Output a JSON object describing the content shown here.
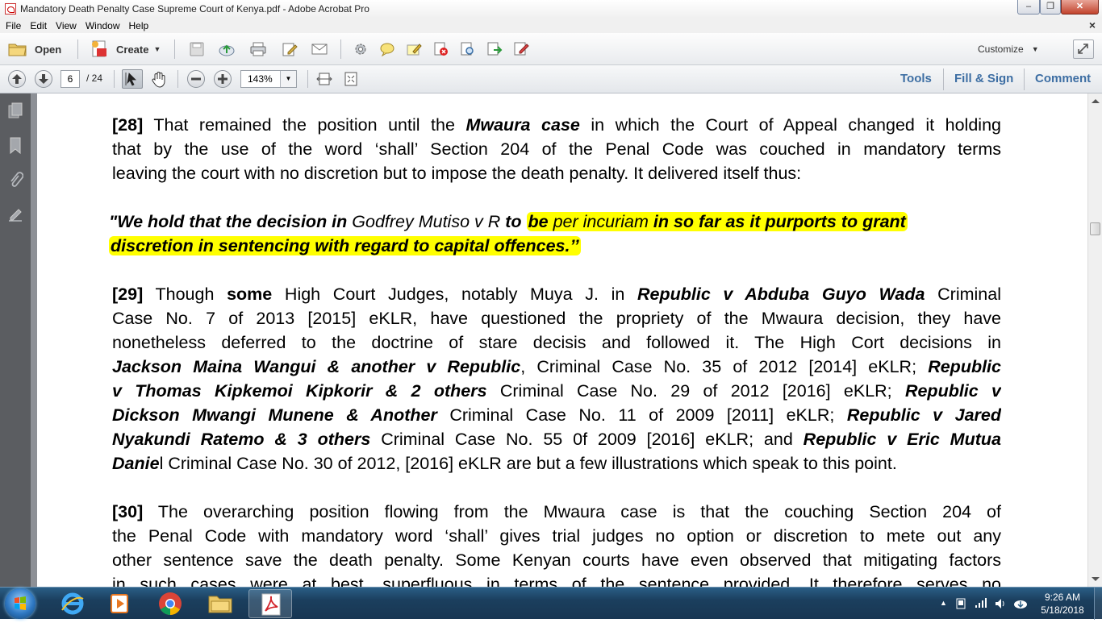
{
  "window": {
    "title": "Mandatory Death Penalty Case Supreme Court of Kenya.pdf - Adobe Acrobat Pro"
  },
  "menu": [
    "File",
    "Edit",
    "View",
    "Window",
    "Help"
  ],
  "toolbar": {
    "open_label": "Open",
    "create_label": "Create",
    "customize_label": "Customize"
  },
  "nav": {
    "current_page": "6",
    "total_pages": "/ 24",
    "zoom": "143%"
  },
  "panes": {
    "tools": "Tools",
    "fill_sign": "Fill & Sign",
    "comment": "Comment"
  },
  "document": {
    "p28": {
      "num": "[28]",
      "l1a": "That remained the position until the ",
      "l1b": "Mwaura case",
      "l1c": "  in which the Court of Appeal changed it holding",
      "l2": "that by the use of the word ‘shall’ Section 204 of the Penal Code was couched in mandatory terms",
      "l3": "leaving the court with no discretion but to impose the death penalty.  It delivered itself thus:"
    },
    "quote": {
      "a": "\"We hold that the decision in ",
      "b": "Godfrey Mutiso v R",
      "c": " to ",
      "d": "be ",
      "e": "per incuriam",
      "f": " in so far as it purports to grant",
      "g": "discretion in sentencing with regard to capital offences.’’"
    },
    "p29": {
      "num": "[29]",
      "l1a": "  Though ",
      "l1b": "some",
      "l1c": " High Court Judges, notably Muya J. in ",
      "l1d": "Republic v Abduba Guyo Wada",
      "l1e": "  Criminal",
      "l2": "Case No. 7 of 2013 [2015] eKLR, have questioned the propriety of the Mwaura decision, they have",
      "l3": "nonetheless deferred to the doctrine of stare decisis and followed it.  The High Cort decisions in",
      "l4a": "Jackson Maina Wangui & another v Republic",
      "l4b": ", Criminal Case No. 35 of 2012 [2014] eKLR; ",
      "l4c": "Republic",
      "l5a": "v Thomas Kipkemoi Kipkorir & 2 others",
      "l5b": " Criminal Case No. 29 of 2012 [2016] eKLR; ",
      "l5c": "Republic v",
      "l6a": "Dickson Mwangi Munene & Another",
      "l6b": " Criminal Case No. 11 of 2009 [2011] eKLR; ",
      "l6c": "Republic v Jared",
      "l7a": "Nyakundi Ratemo & 3 others",
      "l7b": " Criminal Case No. 55 0f 2009 [2016] eKLR;  and ",
      "l7c": "Republic v Eric Mutua",
      "l8a": "Danie",
      "l8b": "l Criminal Case No. 30 of 2012, [2016] eKLR are but a few illustrations which speak to this point."
    },
    "p30": {
      "num": "[30]",
      "l1": " The overarching position flowing from the Mwaura case is that the couching Section 204 of",
      "l2": "the Penal Code with mandatory word ‘shall’ gives trial judges no option or discretion to mete out any",
      "l3": "other sentence save the death penalty. Some Kenyan courts have even observed that mitigating factors",
      "l4": "in such cases were at best, superfluous in terms of the sentence provided. It therefore serves no"
    }
  },
  "taskbar": {
    "time": "9:26 AM",
    "date": "5/18/2018"
  },
  "colors": {
    "highlight": "#ffff00",
    "pane_link": "#3d6ea3"
  }
}
